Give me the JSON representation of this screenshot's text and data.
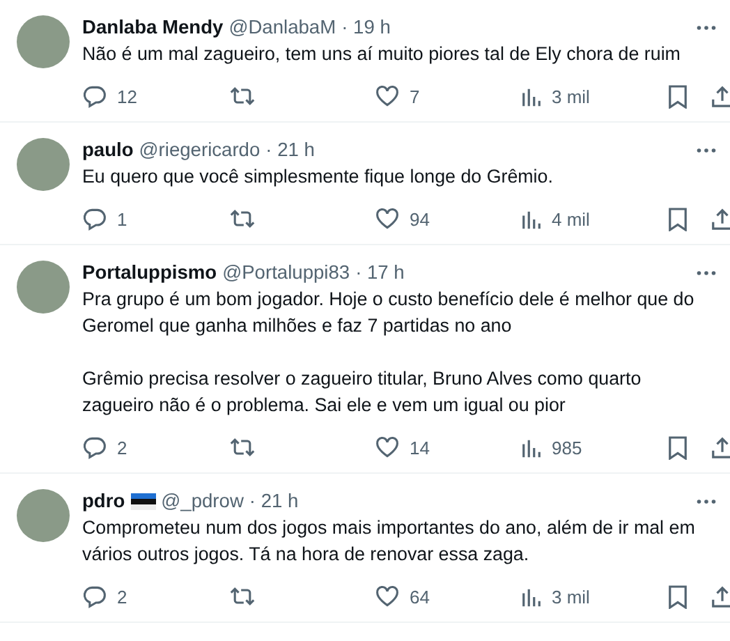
{
  "replies": [
    {
      "name": "Danlaba Mendy",
      "flag": false,
      "handle": "@DanlabaM",
      "time": "· 19 h",
      "paragraphs": [
        "Não é um mal zagueiro,  tem uns aí muito piores tal de Ely chora de ruim"
      ],
      "reply_count": "12",
      "like_count": "7",
      "view_count": "3 mil"
    },
    {
      "name": "paulo",
      "flag": false,
      "handle": "@riegericardo",
      "time": "· 21 h",
      "paragraphs": [
        "Eu quero que você simplesmente fique longe do Grêmio."
      ],
      "reply_count": "1",
      "like_count": "94",
      "view_count": "4 mil"
    },
    {
      "name": "Portaluppismo",
      "flag": false,
      "handle": "@Portaluppi83",
      "time": "· 17 h",
      "paragraphs": [
        "Pra grupo é um bom jogador. Hoje o custo benefício dele é melhor que do Geromel que ganha milhões e faz 7 partidas no ano",
        "Grêmio precisa resolver o zagueiro titular, Bruno Alves como quarto zagueiro não é o problema. Sai ele e vem um igual ou pior"
      ],
      "reply_count": "2",
      "like_count": "14",
      "view_count": "985"
    },
    {
      "name": "pdro",
      "flag": true,
      "handle": "@_pdrow",
      "time": "· 21 h",
      "paragraphs": [
        "Comprometeu num dos jogos mais importantes do ano, além de ir mal em vários outros jogos. Tá na hora de renovar essa zaga."
      ],
      "reply_count": "2",
      "like_count": "64",
      "view_count": "3 mil"
    }
  ]
}
